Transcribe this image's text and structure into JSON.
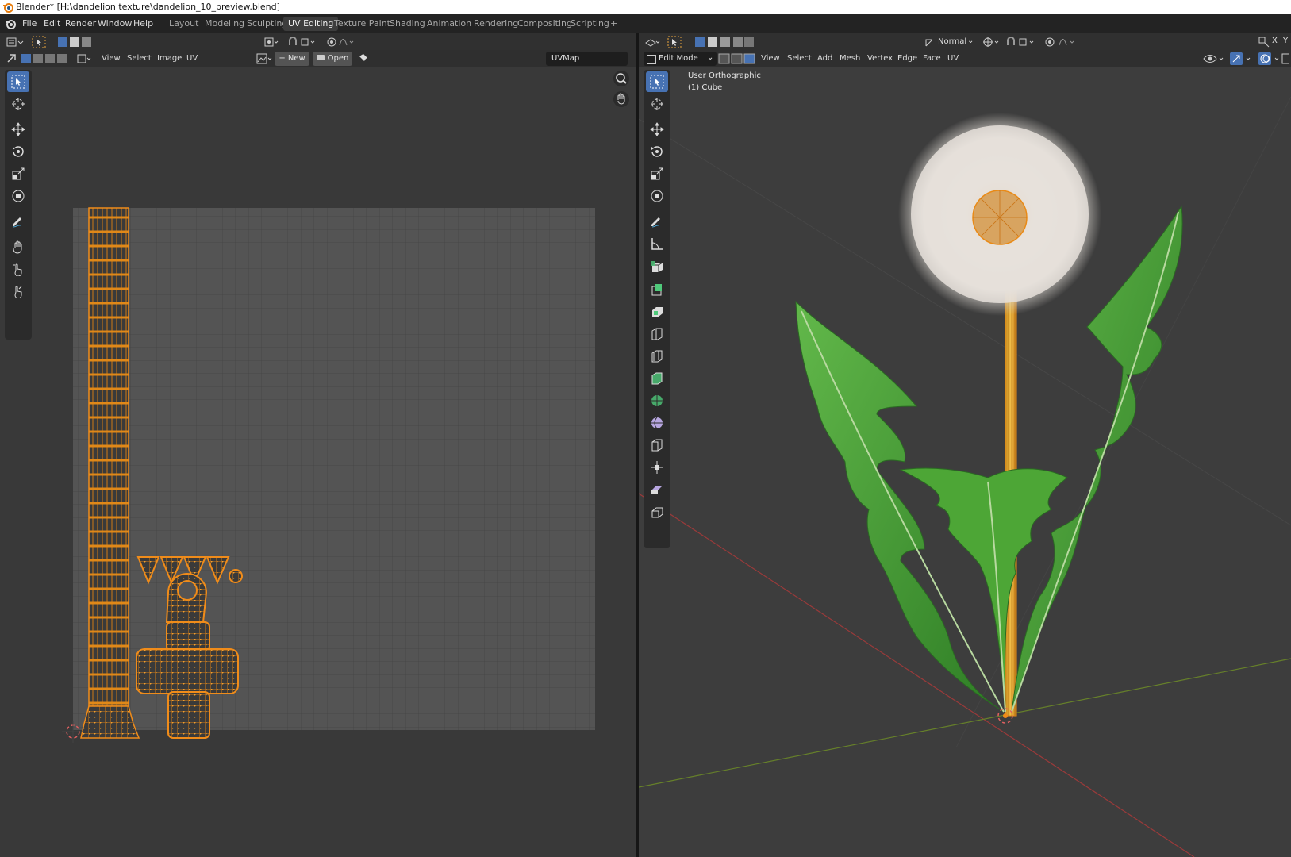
{
  "window": {
    "title": "Blender* [H:\\dandelion texture\\dandelion_10_preview.blend]"
  },
  "menubar": {
    "items": [
      "File",
      "Edit",
      "Render",
      "Window",
      "Help"
    ]
  },
  "workspaces": {
    "tabs": [
      "Layout",
      "Modeling",
      "Sculpting",
      "UV Editing",
      "Texture Paint",
      "Shading",
      "Animation",
      "Rendering",
      "Compositing",
      "Scripting"
    ],
    "active": "UV Editing",
    "add_label": "+"
  },
  "uv_editor": {
    "menus": [
      "View",
      "Select",
      "Image",
      "UV"
    ],
    "new_label": "New",
    "open_label": "Open",
    "uvmap_name": "UVMap"
  },
  "viewport": {
    "mode_label": "Edit Mode",
    "menus": [
      "View",
      "Select",
      "Add",
      "Mesh",
      "Vertex",
      "Edge",
      "Face",
      "UV"
    ],
    "shading_label": "Normal",
    "view_name": "User Orthographic",
    "object_name": "(1) Cube",
    "axis_x": "X",
    "axis_y": "Y"
  },
  "colors": {
    "accent": "#4772b3",
    "uv_orange": "#f08c1a",
    "leaf_green": "#4fa83a",
    "stem_yellow": "#e0a030",
    "x_axis": "#b04040",
    "y_axis": "#6a8a20"
  }
}
